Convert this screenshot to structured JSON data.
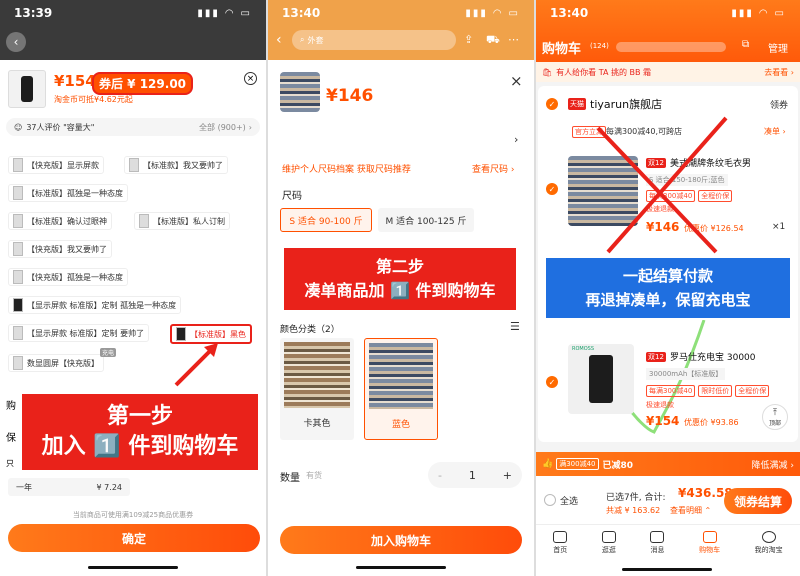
{
  "panel1": {
    "time": "13:39",
    "price_main": "¥154",
    "price_badge": "券后 ¥ 129.00",
    "subsidy": "淘金币可抵¥4.62元起",
    "reviews": "37人评价 \"容量大\"",
    "reviews_all": "全部 (900+)",
    "chips": [
      "【快充版】显示屏款",
      "【标准款】我又要帅了",
      "【标准版】孤独是一种态度",
      "【标准版】确认过眼神",
      "【标准版】私人订制",
      "【快充版】我又要帅了",
      "【快充版】孤独是一种态度",
      "【显示屏款 标准版】定制 孤独是一种态度",
      "【显示屏款 标准版】定制 要帅了",
      "【标准版】黑色",
      "数显圆屏【快充版】"
    ],
    "chip_tag": "充电",
    "partial1": "购",
    "partial2": "保",
    "partial3": "只",
    "year_label": "一年",
    "year_price": "¥ 7.24",
    "coupon_note": "当前商品可使用满109减25商品优惠券",
    "confirm": "确定",
    "callout_line1": "第一步",
    "callout_line2": "加入 1️⃣ 件到购物车"
  },
  "panel2": {
    "time": "13:40",
    "search_placeholder": "外套",
    "price": "¥146",
    "size_tip": "维护个人尺码档案 获取尺码推荐",
    "size_link": "查看尺码 ›",
    "size_label": "尺码",
    "size_options": [
      "S 适合 90-100 斤",
      "M 适合 100-125 斤"
    ],
    "callout_line1": "第二步",
    "callout_line2": "凑单商品加 1️⃣ 件到购物车",
    "color_label": "颜色分类（2）",
    "colors": [
      "卡其色",
      "蓝色"
    ],
    "qty_label": "数量",
    "qty_stock": "有货",
    "qty_minus": "-",
    "qty_value": "1",
    "qty_plus": "+",
    "add_cart": "加入购物车"
  },
  "panel3": {
    "time": "13:40",
    "title": "购物车",
    "count": "(124)",
    "manage": "管理",
    "banner": "有人给你看 TA 挑的 BB 霜",
    "banner_link": "去看看 ›",
    "store_badge": "天猫",
    "store_name": "tiyarun旗舰店",
    "store_coupon": "领券",
    "promo1": "每满300减40,可跨店",
    "promo1_tag": "官方立减",
    "promo1_link": "凑单 ›",
    "item1_tag": "双12",
    "item1_title": "美式潮牌条纹毛衣男",
    "item1_spec": "S 适合 150-180斤;蓝色",
    "item1_tags": [
      "每满300减40",
      "全程价保"
    ],
    "item1_extra": "极速退款",
    "item1_price": "¥146",
    "item1_after": "优惠价 ¥126.54",
    "item1_qty": "×1",
    "callout_line1": "一起结算付款",
    "callout_line2": "再退掉凑单，保留充电宝",
    "item2_tag": "双12",
    "item2_title": "罗马仕充电宝 30000",
    "item2_spec": "30000mAh【标准版】",
    "item2_tags": [
      "每满300减40",
      "限时低价",
      "全程价保"
    ],
    "item2_extra": "极速退款",
    "item2_price": "¥154",
    "item2_after": "优惠价 ¥93.86",
    "item2_brand": "ROMOSS",
    "top_btn": "顶部",
    "discount_tag": "满300减40",
    "discount_text": "已减80",
    "discount_link": "降低满减 ›",
    "select_all": "全选",
    "selected": "已选7件, 合计:",
    "total": "¥436.58",
    "saved": "共减 ¥ 163.62",
    "saved_link": "查看明细 ⌃",
    "checkout": "领券结算",
    "nav": [
      "首页",
      "逛逛",
      "消息",
      "购物车",
      "我的淘宝"
    ]
  },
  "colors": {
    "accent": "#ff5000",
    "callout": "#e9221a",
    "blue_callout": "#1f6fe0"
  }
}
